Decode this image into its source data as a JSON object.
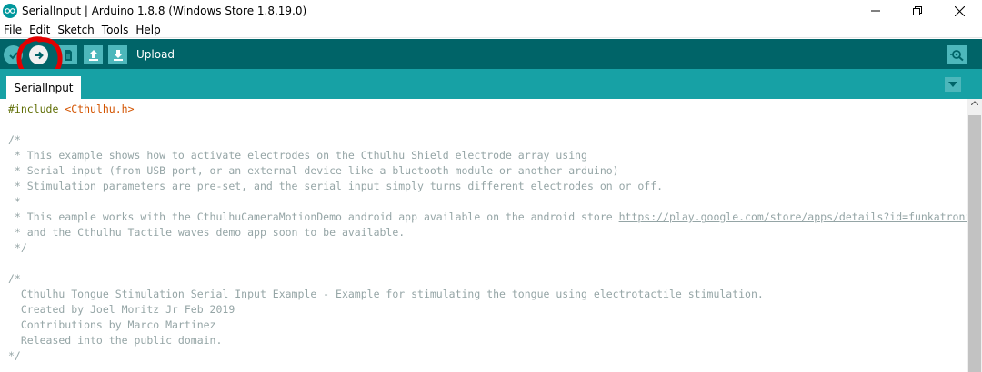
{
  "window": {
    "title": "SerialInput | Arduino 1.8.8 (Windows Store 1.8.19.0)",
    "icon": "arduino-logo-icon"
  },
  "menu": [
    "File",
    "Edit",
    "Sketch",
    "Tools",
    "Help"
  ],
  "toolbar": {
    "buttons": [
      "verify-icon",
      "upload-icon",
      "new-icon",
      "open-icon",
      "save-icon"
    ],
    "hover_label": "Upload",
    "serial_monitor_icon": "serial-monitor-icon",
    "annotation_color": "#e10000"
  },
  "tabs": [
    {
      "label": "SerialInput"
    }
  ],
  "editor": {
    "lines": [
      {
        "directive": "#include",
        "file": "<Cthulhu.h>"
      },
      {
        "text": ""
      },
      {
        "text": "/*"
      },
      {
        "text": " * This example shows how to activate electrodes on the Cthulhu Shield electrode array using"
      },
      {
        "text": " * Serial input (from USB port, or an external device like a bluetooth module or another arduino)"
      },
      {
        "text": " * Stimulation parameters are pre-set, and the serial input simply turns different electrodes on or off."
      },
      {
        "text": " *"
      },
      {
        "text": " * This eample works with the CthulhuCameraMotionDemo android app available on the android store ",
        "link": "https://play.google.com/store/apps/details?id=funkatronics"
      },
      {
        "text": " * and the Cthulhu Tactile waves demo app soon to be available."
      },
      {
        "text": " */"
      },
      {
        "text": ""
      },
      {
        "text": "/*"
      },
      {
        "text": "  Cthulhu Tongue Stimulation Serial Input Example - Example for stimulating the tongue using electrotactile stimulation."
      },
      {
        "text": "  Created by Joel Moritz Jr Feb 2019"
      },
      {
        "text": "  Contributions by Marco Martinez"
      },
      {
        "text": "  Released into the public domain."
      },
      {
        "text": "*/"
      }
    ]
  },
  "colors": {
    "toolbar": "#006468",
    "tabbar": "#17a1a5",
    "button": "#4db7bb",
    "comment": "#95a5a6",
    "directive": "#5e6d03",
    "include_file": "#d35400"
  }
}
